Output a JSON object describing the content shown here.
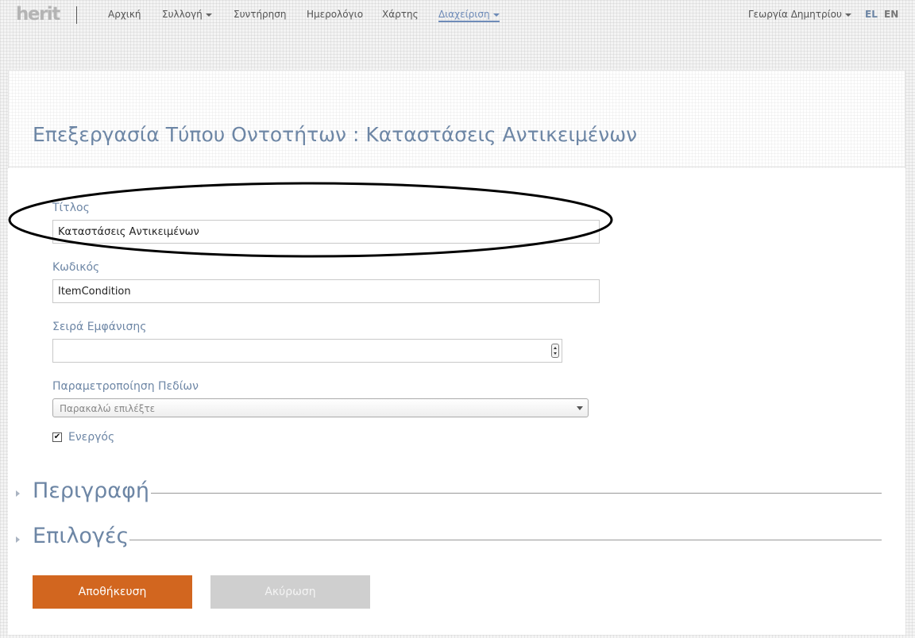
{
  "nav": {
    "logo": "herit",
    "items": [
      {
        "label": "Αρχική",
        "dropdown": false,
        "active": false
      },
      {
        "label": "Συλλογή",
        "dropdown": true,
        "active": false
      },
      {
        "label": "Συντήρηση",
        "dropdown": false,
        "active": false
      },
      {
        "label": "Ημερολόγιο",
        "dropdown": false,
        "active": false
      },
      {
        "label": "Χάρτης",
        "dropdown": false,
        "active": false
      },
      {
        "label": "Διαχείριση",
        "dropdown": true,
        "active": true
      }
    ],
    "user": "Γεωργία Δημητρίου",
    "languages": [
      {
        "code": "EL",
        "active": true
      },
      {
        "code": "EN",
        "active": false
      }
    ]
  },
  "page": {
    "title": "Επεξεργασία Τύπου Οντοτήτων : Καταστάσεις Αντικειμένων"
  },
  "form": {
    "title_label": "Τίτλος",
    "title_value": "Καταστάσεις Αντικειμένων",
    "code_label": "Κωδικός",
    "code_value": "ItemCondition",
    "order_label": "Σειρά Εμφάνισης",
    "order_value": "",
    "fields_label": "Παραμετροποίηση Πεδίων",
    "fields_placeholder": "Παρακαλώ επιλέξτε",
    "active_label": "Ενεργός",
    "active_checked": true
  },
  "sections": [
    {
      "title": "Περιγραφή"
    },
    {
      "title": "Επιλογές"
    }
  ],
  "buttons": {
    "save": "Αποθήκευση",
    "cancel": "Ακύρωση"
  },
  "colors": {
    "accent": "#6d86a5",
    "save_button": "#d2661f",
    "cancel_button": "#cfcfcf",
    "annotation": "#000000"
  }
}
